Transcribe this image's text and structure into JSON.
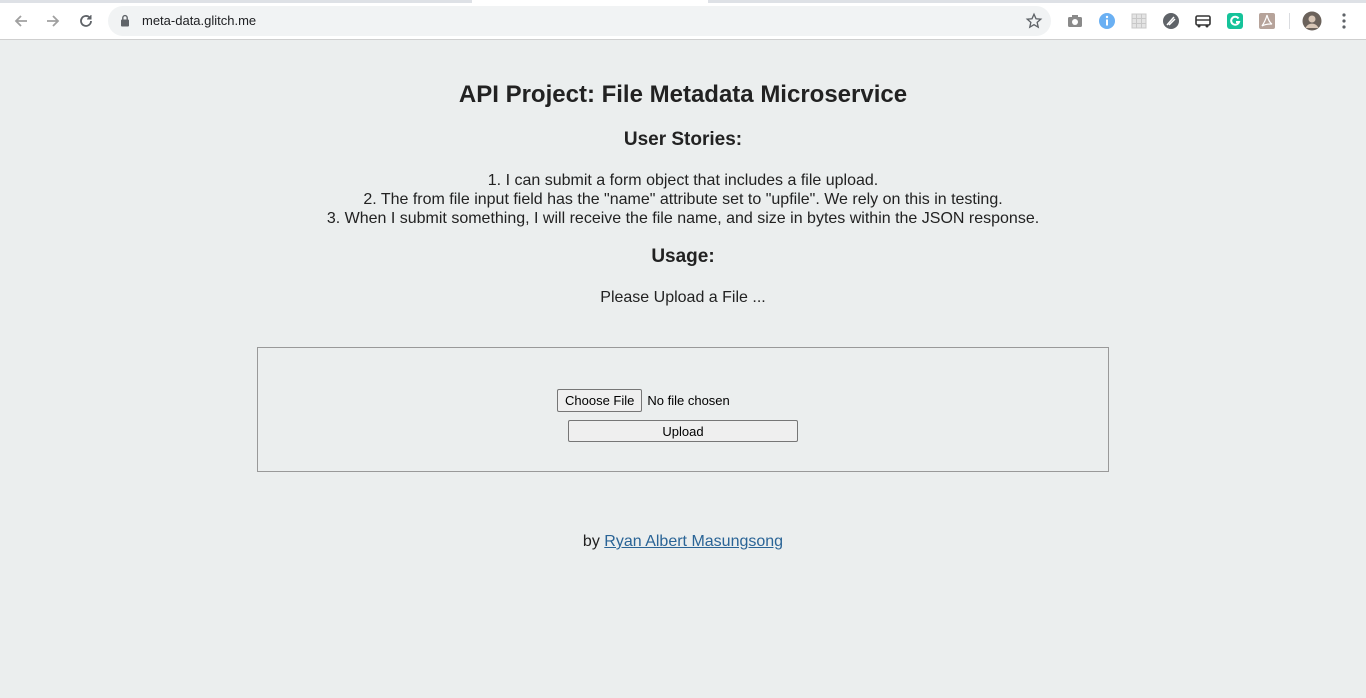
{
  "browser": {
    "url": "meta-data.glitch.me",
    "icons": {
      "back": "arrow-left-icon",
      "forward": "arrow-right-icon",
      "reload": "reload-icon",
      "lock": "lock-icon",
      "bookmark": "star-icon",
      "menu": "vertical-dots-icon"
    },
    "extensions": [
      "camera-icon",
      "info-icon",
      "grid-icon",
      "rocket-icon",
      "bus-icon",
      "grammarly-icon",
      "pdf-icon",
      "profile-avatar"
    ]
  },
  "page": {
    "title": "API Project: File Metadata Microservice",
    "stories_heading": "User Stories:",
    "stories": [
      "1. I can submit a form object that includes a file upload.",
      "2. The from file input field has the \"name\" attribute set to \"upfile\". We rely on this in testing.",
      "3. When I submit something, I will receive the file name, and size in bytes within the JSON response."
    ],
    "usage_heading": "Usage:",
    "usage_prompt": "Please Upload a File ...",
    "form": {
      "choose_label": "Choose File",
      "file_status": "No file chosen",
      "upload_label": "Upload"
    },
    "byline_prefix": "by",
    "author": "Ryan Albert Masungsong"
  },
  "colors": {
    "background": "#ebeeee",
    "link": "#2a6496"
  }
}
